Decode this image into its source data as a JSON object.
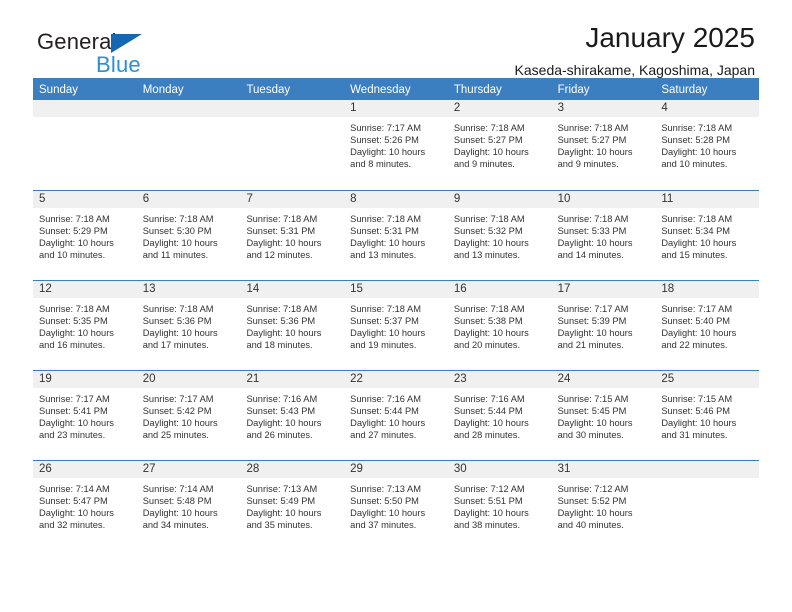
{
  "brand": {
    "name_top": "General",
    "name_bottom": "Blue",
    "color_dark": "#231f20",
    "color_blue": "#2b8fd6",
    "triangle_color": "#1567b3"
  },
  "header": {
    "title": "January 2025",
    "subtitle": "Kaseda-shirakame, Kagoshima, Japan"
  },
  "theme": {
    "header_row_bg": "#3c7fc1",
    "header_row_text": "#ffffff",
    "daynum_band_bg": "#f0f0f0",
    "cell_text": "#333333",
    "page_bg": "#ffffff"
  },
  "weekdays": [
    "Sunday",
    "Monday",
    "Tuesday",
    "Wednesday",
    "Thursday",
    "Friday",
    "Saturday"
  ],
  "labels": {
    "sunrise_prefix": "Sunrise:",
    "sunset_prefix": "Sunset:",
    "daylight_prefix": "Daylight:"
  },
  "weeks": [
    [
      {
        "day": "",
        "sunrise": "",
        "sunset": "",
        "daylight_line1": "",
        "daylight_line2": ""
      },
      {
        "day": "",
        "sunrise": "",
        "sunset": "",
        "daylight_line1": "",
        "daylight_line2": ""
      },
      {
        "day": "",
        "sunrise": "",
        "sunset": "",
        "daylight_line1": "",
        "daylight_line2": ""
      },
      {
        "day": "1",
        "sunrise": "Sunrise: 7:17 AM",
        "sunset": "Sunset: 5:26 PM",
        "daylight_line1": "Daylight: 10 hours",
        "daylight_line2": "and 8 minutes."
      },
      {
        "day": "2",
        "sunrise": "Sunrise: 7:18 AM",
        "sunset": "Sunset: 5:27 PM",
        "daylight_line1": "Daylight: 10 hours",
        "daylight_line2": "and 9 minutes."
      },
      {
        "day": "3",
        "sunrise": "Sunrise: 7:18 AM",
        "sunset": "Sunset: 5:27 PM",
        "daylight_line1": "Daylight: 10 hours",
        "daylight_line2": "and 9 minutes."
      },
      {
        "day": "4",
        "sunrise": "Sunrise: 7:18 AM",
        "sunset": "Sunset: 5:28 PM",
        "daylight_line1": "Daylight: 10 hours",
        "daylight_line2": "and 10 minutes."
      }
    ],
    [
      {
        "day": "5",
        "sunrise": "Sunrise: 7:18 AM",
        "sunset": "Sunset: 5:29 PM",
        "daylight_line1": "Daylight: 10 hours",
        "daylight_line2": "and 10 minutes."
      },
      {
        "day": "6",
        "sunrise": "Sunrise: 7:18 AM",
        "sunset": "Sunset: 5:30 PM",
        "daylight_line1": "Daylight: 10 hours",
        "daylight_line2": "and 11 minutes."
      },
      {
        "day": "7",
        "sunrise": "Sunrise: 7:18 AM",
        "sunset": "Sunset: 5:31 PM",
        "daylight_line1": "Daylight: 10 hours",
        "daylight_line2": "and 12 minutes."
      },
      {
        "day": "8",
        "sunrise": "Sunrise: 7:18 AM",
        "sunset": "Sunset: 5:31 PM",
        "daylight_line1": "Daylight: 10 hours",
        "daylight_line2": "and 13 minutes."
      },
      {
        "day": "9",
        "sunrise": "Sunrise: 7:18 AM",
        "sunset": "Sunset: 5:32 PM",
        "daylight_line1": "Daylight: 10 hours",
        "daylight_line2": "and 13 minutes."
      },
      {
        "day": "10",
        "sunrise": "Sunrise: 7:18 AM",
        "sunset": "Sunset: 5:33 PM",
        "daylight_line1": "Daylight: 10 hours",
        "daylight_line2": "and 14 minutes."
      },
      {
        "day": "11",
        "sunrise": "Sunrise: 7:18 AM",
        "sunset": "Sunset: 5:34 PM",
        "daylight_line1": "Daylight: 10 hours",
        "daylight_line2": "and 15 minutes."
      }
    ],
    [
      {
        "day": "12",
        "sunrise": "Sunrise: 7:18 AM",
        "sunset": "Sunset: 5:35 PM",
        "daylight_line1": "Daylight: 10 hours",
        "daylight_line2": "and 16 minutes."
      },
      {
        "day": "13",
        "sunrise": "Sunrise: 7:18 AM",
        "sunset": "Sunset: 5:36 PM",
        "daylight_line1": "Daylight: 10 hours",
        "daylight_line2": "and 17 minutes."
      },
      {
        "day": "14",
        "sunrise": "Sunrise: 7:18 AM",
        "sunset": "Sunset: 5:36 PM",
        "daylight_line1": "Daylight: 10 hours",
        "daylight_line2": "and 18 minutes."
      },
      {
        "day": "15",
        "sunrise": "Sunrise: 7:18 AM",
        "sunset": "Sunset: 5:37 PM",
        "daylight_line1": "Daylight: 10 hours",
        "daylight_line2": "and 19 minutes."
      },
      {
        "day": "16",
        "sunrise": "Sunrise: 7:18 AM",
        "sunset": "Sunset: 5:38 PM",
        "daylight_line1": "Daylight: 10 hours",
        "daylight_line2": "and 20 minutes."
      },
      {
        "day": "17",
        "sunrise": "Sunrise: 7:17 AM",
        "sunset": "Sunset: 5:39 PM",
        "daylight_line1": "Daylight: 10 hours",
        "daylight_line2": "and 21 minutes."
      },
      {
        "day": "18",
        "sunrise": "Sunrise: 7:17 AM",
        "sunset": "Sunset: 5:40 PM",
        "daylight_line1": "Daylight: 10 hours",
        "daylight_line2": "and 22 minutes."
      }
    ],
    [
      {
        "day": "19",
        "sunrise": "Sunrise: 7:17 AM",
        "sunset": "Sunset: 5:41 PM",
        "daylight_line1": "Daylight: 10 hours",
        "daylight_line2": "and 23 minutes."
      },
      {
        "day": "20",
        "sunrise": "Sunrise: 7:17 AM",
        "sunset": "Sunset: 5:42 PM",
        "daylight_line1": "Daylight: 10 hours",
        "daylight_line2": "and 25 minutes."
      },
      {
        "day": "21",
        "sunrise": "Sunrise: 7:16 AM",
        "sunset": "Sunset: 5:43 PM",
        "daylight_line1": "Daylight: 10 hours",
        "daylight_line2": "and 26 minutes."
      },
      {
        "day": "22",
        "sunrise": "Sunrise: 7:16 AM",
        "sunset": "Sunset: 5:44 PM",
        "daylight_line1": "Daylight: 10 hours",
        "daylight_line2": "and 27 minutes."
      },
      {
        "day": "23",
        "sunrise": "Sunrise: 7:16 AM",
        "sunset": "Sunset: 5:44 PM",
        "daylight_line1": "Daylight: 10 hours",
        "daylight_line2": "and 28 minutes."
      },
      {
        "day": "24",
        "sunrise": "Sunrise: 7:15 AM",
        "sunset": "Sunset: 5:45 PM",
        "daylight_line1": "Daylight: 10 hours",
        "daylight_line2": "and 30 minutes."
      },
      {
        "day": "25",
        "sunrise": "Sunrise: 7:15 AM",
        "sunset": "Sunset: 5:46 PM",
        "daylight_line1": "Daylight: 10 hours",
        "daylight_line2": "and 31 minutes."
      }
    ],
    [
      {
        "day": "26",
        "sunrise": "Sunrise: 7:14 AM",
        "sunset": "Sunset: 5:47 PM",
        "daylight_line1": "Daylight: 10 hours",
        "daylight_line2": "and 32 minutes."
      },
      {
        "day": "27",
        "sunrise": "Sunrise: 7:14 AM",
        "sunset": "Sunset: 5:48 PM",
        "daylight_line1": "Daylight: 10 hours",
        "daylight_line2": "and 34 minutes."
      },
      {
        "day": "28",
        "sunrise": "Sunrise: 7:13 AM",
        "sunset": "Sunset: 5:49 PM",
        "daylight_line1": "Daylight: 10 hours",
        "daylight_line2": "and 35 minutes."
      },
      {
        "day": "29",
        "sunrise": "Sunrise: 7:13 AM",
        "sunset": "Sunset: 5:50 PM",
        "daylight_line1": "Daylight: 10 hours",
        "daylight_line2": "and 37 minutes."
      },
      {
        "day": "30",
        "sunrise": "Sunrise: 7:12 AM",
        "sunset": "Sunset: 5:51 PM",
        "daylight_line1": "Daylight: 10 hours",
        "daylight_line2": "and 38 minutes."
      },
      {
        "day": "31",
        "sunrise": "Sunrise: 7:12 AM",
        "sunset": "Sunset: 5:52 PM",
        "daylight_line1": "Daylight: 10 hours",
        "daylight_line2": "and 40 minutes."
      },
      {
        "day": "",
        "sunrise": "",
        "sunset": "",
        "daylight_line1": "",
        "daylight_line2": ""
      }
    ]
  ]
}
